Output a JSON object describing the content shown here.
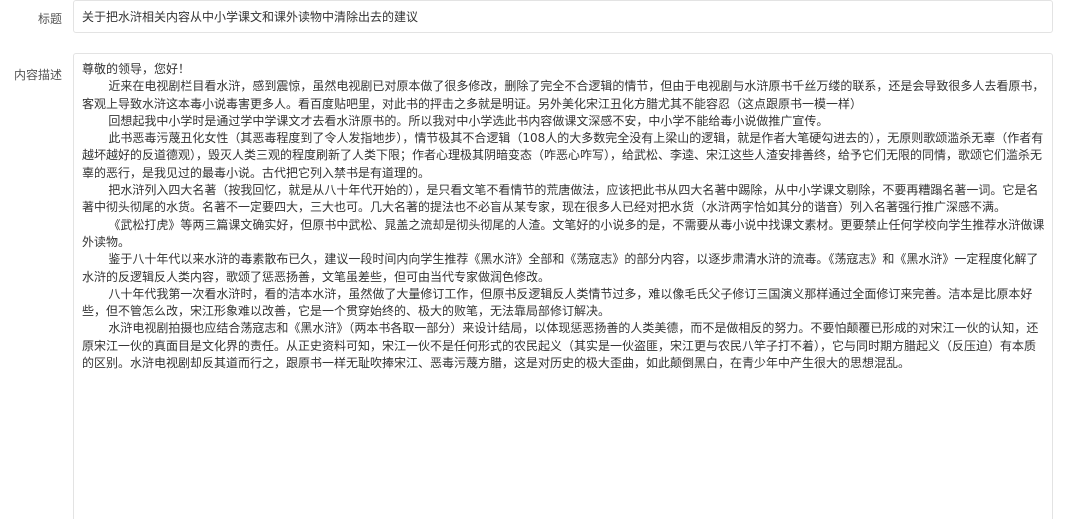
{
  "form": {
    "title_label": "标题",
    "title_value": "关于把水浒相关内容从中小学课文和课外读物中清除出去的建议",
    "desc_label": "内容描述",
    "greeting": "尊敬的领导，您好！",
    "paragraphs": [
      "近来在电视剧栏目看水浒，感到震惊，虽然电视剧已对原本做了很多修改，删除了完全不合逻辑的情节，但由于电视剧与水浒原书千丝万缕的联系，还是会导致很多人去看原书，客观上导致水浒这本毒小说毒害更多人。看百度贴吧里，对此书的抨击之多就是明证。另外美化宋江丑化方腊尤其不能容忍（这点跟原书一模一样）",
      "回想起我中小学时是通过学中学课文才去看水浒原书的。所以我对中小学选此书内容做课文深感不安，中小学不能给毒小说做推广宣传。",
      "此书恶毒污蔑丑化女性（其恶毒程度到了令人发指地步），情节极其不合逻辑（108人的大多数完全没有上梁山的逻辑，就是作者大笔硬勾进去的），无原则歌颂滥杀无辜（作者有越坏越好的反道德观），毁灭人类三观的程度刷新了人类下限；作者心理极其阴暗变态（咋恶心咋写），给武松、李逵、宋江这些人渣安排善终，给予它们无限的同情，歌颂它们滥杀无辜的恶行，是我见过的最毒小说。古代把它列入禁书是有道理的。",
      "把水浒列入四大名著（按我回忆，就是从八十年代开始的），是只看文笔不看情节的荒唐做法，应该把此书从四大名著中踢除，从中小学课文剔除，不要再糟蹋名著一词。它是名著中彻头彻尾的水货。名著不一定要四大，三大也可。几大名著的提法也不必盲从某专家，现在很多人已经对把水货（水浒两字恰如其分的谐音）列入名著强行推广深感不满。",
      "《武松打虎》等两三篇课文确实好，但原书中武松、晁盖之流却是彻头彻尾的人渣。文笔好的小说多的是，不需要从毒小说中找课文素材。更要禁止任何学校向学生推荐水浒做课外读物。",
      "鉴于八十年代以来水浒的毒素散布已久，建议一段时间内向学生推荐《黑水浒》全部和《荡寇志》的部分内容，以逐步肃清水浒的流毒。《荡寇志》和《黑水浒》一定程度化解了水浒的反逻辑反人类内容，歌颂了惩恶扬善，文笔虽差些，但可由当代专家做润色修改。",
      "八十年代我第一次看水浒时，看的洁本水浒，虽然做了大量修订工作，但原书反逻辑反人类情节过多，难以像毛氏父子修订三国演义那样通过全面修订来完善。洁本是比原本好些，但不管怎么改，宋江形象难以改善，它是一个贯穿始终的、极大的败笔，无法靠局部修订解决。",
      "水浒电视剧拍摄也应结合荡寇志和《黑水浒》（两本书各取一部分）来设计结局，以体现惩恶扬善的人类美德，而不是做相反的努力。不要怕颠覆已形成的对宋江一伙的认知，还原宋江一伙的真面目是文化界的责任。从正史资料可知，宋江一伙不是任何形式的农民起义（其实是一伙盗匪，宋江更与农民八竿子打不着），它与同时期方腊起义（反压迫）有本质的区别。水浒电视剧却反其道而行之，跟原书一样无耻吹捧宋江、恶毒污蔑方腊，这是对历史的极大歪曲，如此颠倒黑白，在青少年中产生很大的思想混乱。"
    ]
  }
}
